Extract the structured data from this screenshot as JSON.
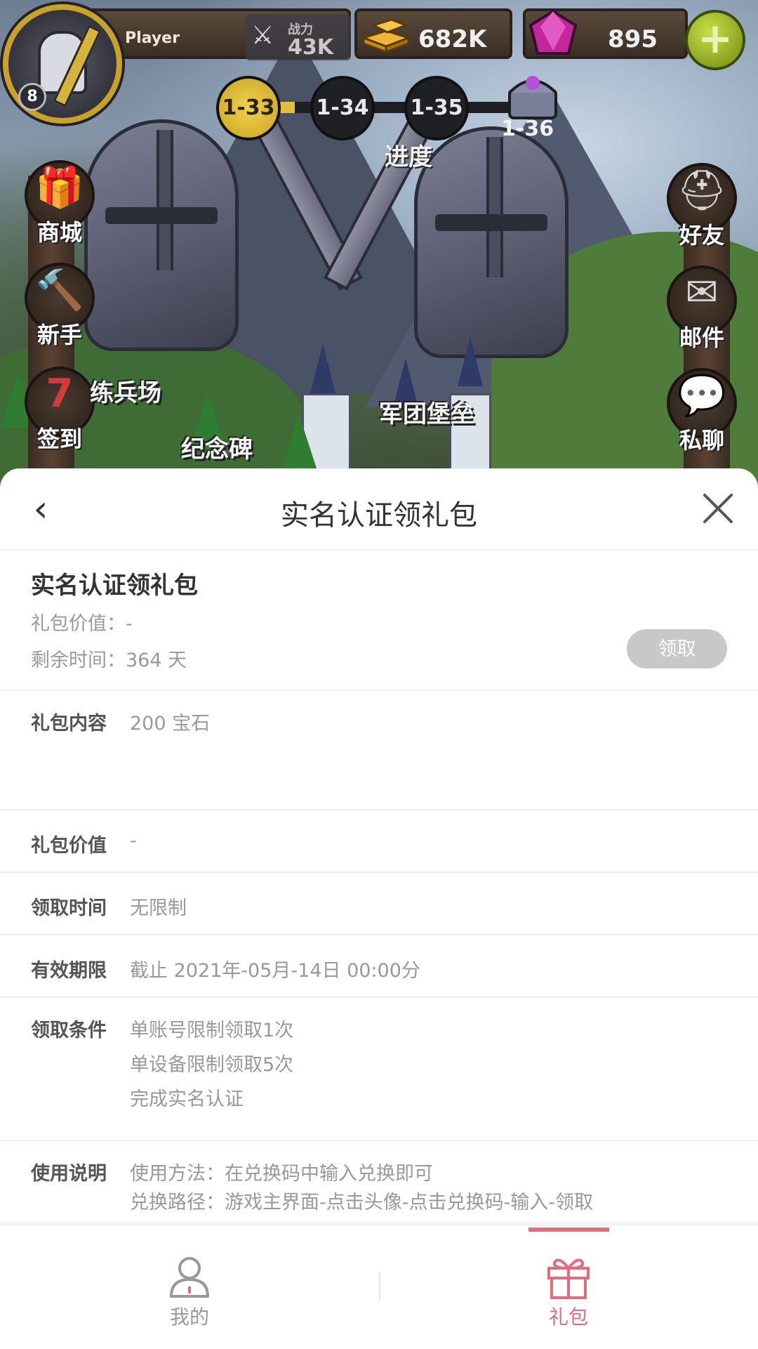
{
  "hud": {
    "player_name": "Player",
    "level": "8",
    "power_label": "战力",
    "power_value": "43K",
    "gold": "682K",
    "gems": "895",
    "plus_icon": "plus-icon"
  },
  "stages": {
    "nodes": [
      "1-33",
      "1-34",
      "1-35"
    ],
    "chest_label": "1-36",
    "progress_label": "进度"
  },
  "side_buttons": {
    "left": [
      "商城",
      "新手",
      "签到"
    ],
    "right": [
      "好友",
      "邮件",
      "私聊"
    ]
  },
  "map_labels": {
    "training": "练兵场",
    "monument": "纪念碑",
    "fortress": "军团堡垒"
  },
  "sheet": {
    "title": "实名认证领礼包",
    "summary": {
      "name": "实名认证领礼包",
      "value_line": "礼包价值：-",
      "time_line": "剩余时间：364 天",
      "claim_label": "领取"
    },
    "details": [
      {
        "label": "礼包内容",
        "lines": [
          "200 宝石"
        ]
      },
      {
        "label": "礼包价值",
        "lines": [
          "-"
        ]
      },
      {
        "label": "领取时间",
        "lines": [
          "无限制"
        ]
      },
      {
        "label": "有效期限",
        "lines": [
          "截止 2021年-05月-14日 00:00分"
        ]
      },
      {
        "label": "领取条件",
        "lines": [
          "单账号限制领取1次",
          "单设备限制领取5次",
          "完成实名认证"
        ]
      },
      {
        "label": "使用说明",
        "lines": [
          "使用方法：在兑换码中输入兑换即可",
          "兑换路径：游戏主界面-点击头像-点击兑换码-输入-领取"
        ]
      }
    ]
  },
  "tabbar": {
    "tabs": [
      {
        "label": "我的",
        "icon": "user-icon"
      },
      {
        "label": "礼包",
        "icon": "gift-icon"
      }
    ],
    "active": "礼包",
    "accent": "#e26d7e"
  }
}
